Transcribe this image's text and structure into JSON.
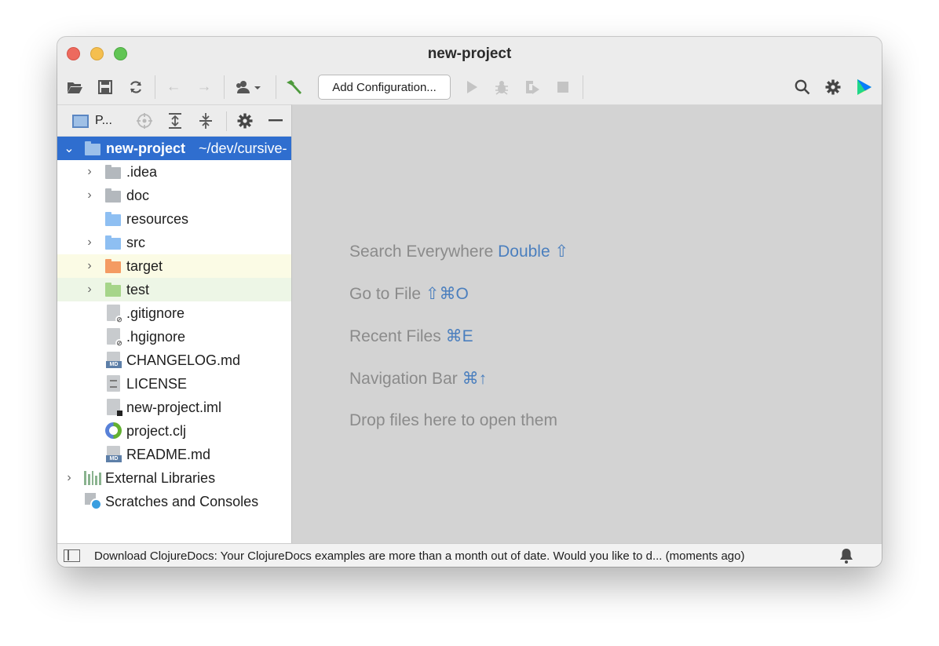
{
  "window": {
    "title": "new-project"
  },
  "toolbar": {
    "config_button_label": "Add Configuration...",
    "icons": [
      "open-folder-icon",
      "save-icon",
      "sync-icon",
      "back-arrow-icon",
      "forward-arrow-icon",
      "vcs-user-icon",
      "build-hammer-icon",
      "run-icon",
      "debug-icon",
      "run-with-coverage-icon",
      "stop-icon",
      "search-icon",
      "settings-gear-icon",
      "ide-logo-icon"
    ]
  },
  "project_pane": {
    "title": "P...",
    "root": {
      "name": "new-project",
      "path": "~/dev/cursive-"
    },
    "items": [
      {
        "label": ".idea",
        "kind": "folder"
      },
      {
        "label": "doc",
        "kind": "folder"
      },
      {
        "label": "resources",
        "kind": "folder"
      },
      {
        "label": "src",
        "kind": "folder"
      },
      {
        "label": "target",
        "kind": "folder"
      },
      {
        "label": "test",
        "kind": "folder"
      },
      {
        "label": ".gitignore",
        "kind": "file"
      },
      {
        "label": ".hgignore",
        "kind": "file"
      },
      {
        "label": "CHANGELOG.md",
        "kind": "file"
      },
      {
        "label": "LICENSE",
        "kind": "file"
      },
      {
        "label": "new-project.iml",
        "kind": "file"
      },
      {
        "label": "project.clj",
        "kind": "file"
      },
      {
        "label": "README.md",
        "kind": "file"
      }
    ],
    "external_libraries": "External Libraries",
    "scratches": "Scratches and Consoles",
    "md_badge": "MD"
  },
  "editor": {
    "hints": [
      {
        "text": "Search Everywhere",
        "shortcut": "Double ⇧"
      },
      {
        "text": "Go to File",
        "shortcut": "⇧⌘O"
      },
      {
        "text": "Recent Files",
        "shortcut": "⌘E"
      },
      {
        "text": "Navigation Bar",
        "shortcut": "⌘↑"
      },
      {
        "text": "Drop files here to open them",
        "shortcut": ""
      }
    ]
  },
  "statusbar": {
    "message": "Download ClojureDocs: Your ClojureDocs examples are more than a month out of date. Would you like to d... (moments ago)"
  },
  "colors": {
    "selection": "#2f6ecf",
    "shortcut": "#4b7fbe",
    "editor_bg": "#d3d3d3"
  }
}
